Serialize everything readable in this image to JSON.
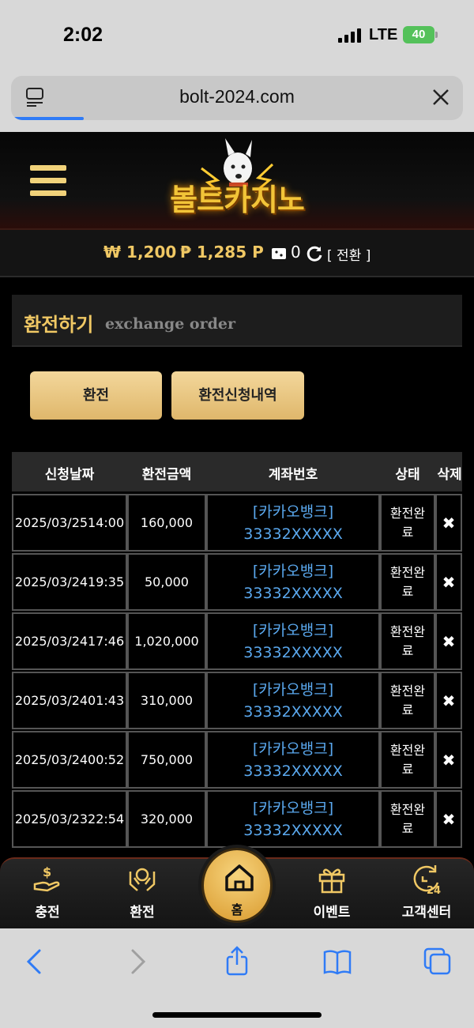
{
  "status": {
    "time": "2:02",
    "network": "LTE",
    "battery": "40"
  },
  "browser": {
    "url": "bolt-2024.com",
    "progress": 0.16
  },
  "site": {
    "logo_text": "볼트카지노"
  },
  "balance": {
    "won": "₩ 1,200",
    "point": "₱ 1,285 P",
    "coupon": "0",
    "switch_label": "[ 전환 ]"
  },
  "panel": {
    "title": "환전하기",
    "subtitle": "exchange order"
  },
  "buttons": {
    "exchange": "환전",
    "history": "환전신청내역"
  },
  "table": {
    "headers": [
      "신청날짜",
      "환전금액",
      "계좌번호",
      "상태",
      "삭제"
    ],
    "rows": [
      {
        "date": "2025/03/25",
        "time": "14:00",
        "amount": "160,000",
        "bank": "[카카오뱅크]",
        "account": "33332XXXXX",
        "status": "환전완료"
      },
      {
        "date": "2025/03/24",
        "time": "19:35",
        "amount": "50,000",
        "bank": "[카카오뱅크]",
        "account": "33332XXXXX",
        "status": "환전완료"
      },
      {
        "date": "2025/03/24",
        "time": "17:46",
        "amount": "1,020,000",
        "bank": "[카카오뱅크]",
        "account": "33332XXXXX",
        "status": "환전완료"
      },
      {
        "date": "2025/03/24",
        "time": "01:43",
        "amount": "310,000",
        "bank": "[카카오뱅크]",
        "account": "33332XXXXX",
        "status": "환전완료"
      },
      {
        "date": "2025/03/24",
        "time": "00:52",
        "amount": "750,000",
        "bank": "[카카오뱅크]",
        "account": "33332XXXXX",
        "status": "환전완료"
      },
      {
        "date": "2025/03/23",
        "time": "22:54",
        "amount": "320,000",
        "bank": "[카카오뱅크]",
        "account": "33332XXXXX",
        "status": "환전완료"
      }
    ],
    "delete_symbol": "✖"
  },
  "bottom_nav": {
    "charge": "충전",
    "exchange": "환전",
    "home": "홈",
    "event": "이벤트",
    "support": "고객센터"
  },
  "colors": {
    "gold": "#f0c864",
    "link": "#5aa8ee",
    "button": "#e8c47f"
  },
  "icons": {
    "status": [
      "signal-icon",
      "battery-icon"
    ],
    "browser": [
      "reader-icon",
      "close-icon",
      "back-icon",
      "forward-icon",
      "share-icon",
      "bookmarks-icon",
      "tabs-icon"
    ],
    "nav": [
      "money-hand-icon",
      "hands-coin-icon",
      "home-icon",
      "gift-icon",
      "support-24-icon"
    ],
    "balance": [
      "won-icon",
      "point-icon",
      "coupon-icon",
      "refresh-icon"
    ]
  }
}
